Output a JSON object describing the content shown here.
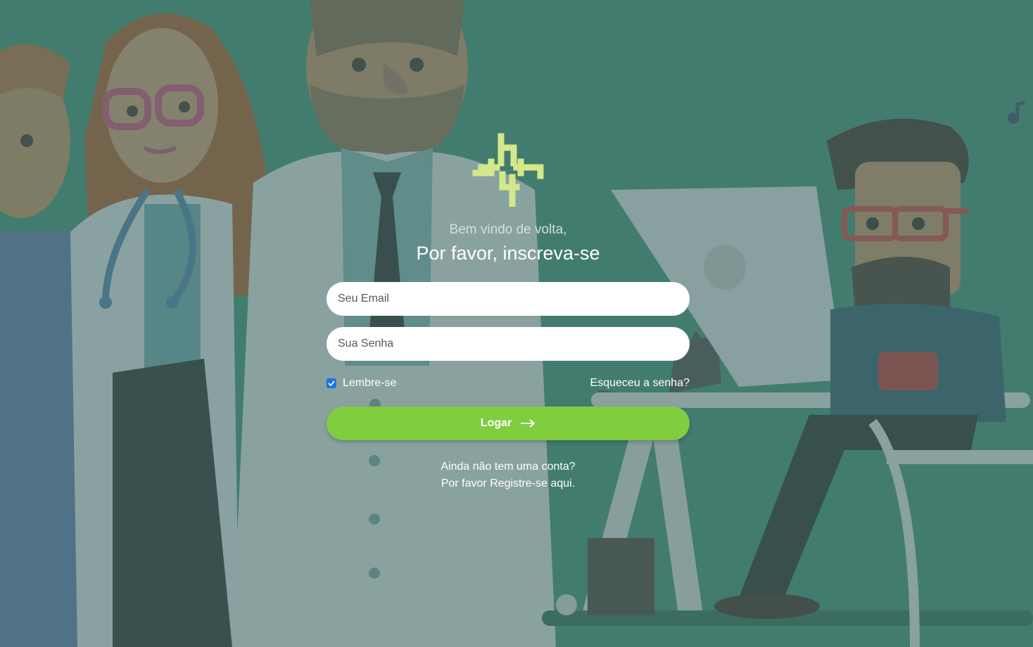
{
  "welcome": "Bem vindo de volta,",
  "title": "Por favor, inscreva-se",
  "form": {
    "email_placeholder": "Seu Email",
    "password_placeholder": "Sua Senha",
    "remember_label": "Lembre-se",
    "remember_checked": true,
    "forgot_label": "Esqueceu a senha?",
    "submit_label": "Logar"
  },
  "register": {
    "line1": "Ainda não tem uma conta?",
    "line2": "Por favor Registre-se aqui."
  },
  "colors": {
    "background": "#2a8a6b",
    "accent": "#80cd3f",
    "logo": "#d4e88a",
    "checkbox": "#1a73e8"
  },
  "icons": {
    "logo": "h4-cross-logo",
    "submit": "arrow-right-icon",
    "check": "check-icon",
    "music": "music-note-icon"
  }
}
